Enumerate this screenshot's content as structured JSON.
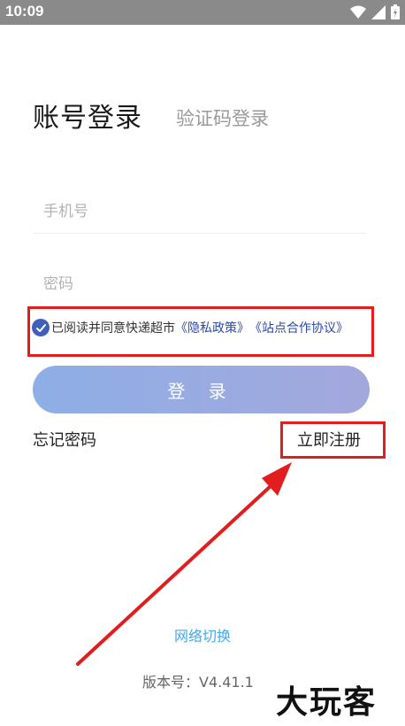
{
  "status_bar": {
    "time": "10:09"
  },
  "tabs": {
    "account_login": "账号登录",
    "code_login": "验证码登录"
  },
  "form": {
    "phone_placeholder": "手机号",
    "password_placeholder": "密码"
  },
  "agreement": {
    "text": "已阅读并同意快递超市",
    "privacy_link": "《隐私政策》",
    "site_link": "《站点合作协议》"
  },
  "actions": {
    "login_label": "登 录",
    "forgot_label": "忘记密码",
    "register_label": "立即注册"
  },
  "footer": {
    "network_switch": "网络切换",
    "version": "版本号：V4.41.1"
  },
  "watermark": {
    "text": "大玩客"
  },
  "colors": {
    "accent_blue": "#3f5fbf",
    "link_blue": "#2b4aa8",
    "network_link": "#45a9e8",
    "annotation_red": "#e31d1d"
  }
}
